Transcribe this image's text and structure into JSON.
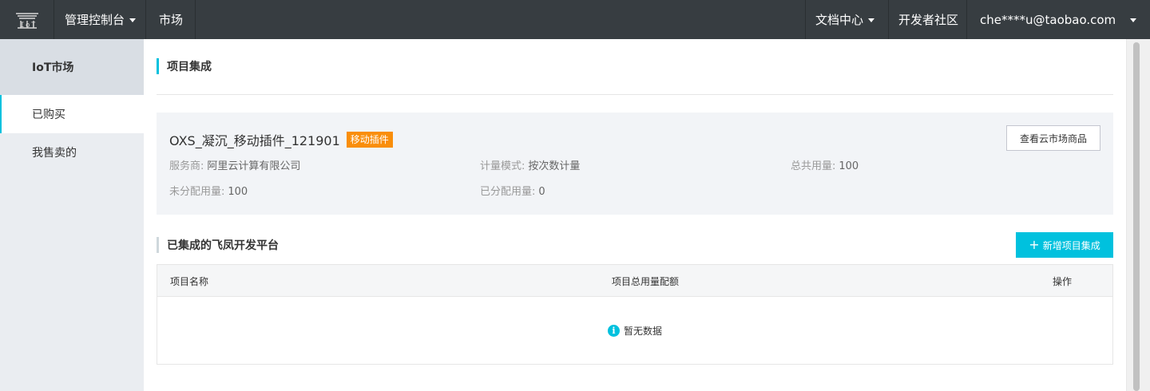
{
  "topbar": {
    "logo_icon": "iot-logo-icon",
    "console_label": "管理控制台",
    "market_label": "市场",
    "docs_label": "文档中心",
    "dev_community_label": "开发者社区",
    "user_label": "che****u@taobao.com"
  },
  "sidebar": {
    "header": "IoT市场",
    "items": [
      {
        "label": "已购买",
        "active": true
      },
      {
        "label": "我售卖的",
        "active": false
      }
    ]
  },
  "main": {
    "section1_title": "项目集成",
    "card": {
      "product_name": "OXS_凝沉_移动插件_121901",
      "tag": "移动插件",
      "view_button": "查看云市场商品",
      "fields": {
        "provider_label": "服务商:",
        "provider_value": "阿里云计算有限公司",
        "metering_label": "计量模式:",
        "metering_value": "按次数计量",
        "total_label": "总共用量:",
        "total_value": "100",
        "unallocated_label": "未分配用量:",
        "unallocated_value": "100",
        "allocated_label": "已分配用量:",
        "allocated_value": "0"
      }
    },
    "section2_title": "已集成的飞凤开发平台",
    "add_button": "新增项目集成",
    "table": {
      "columns": [
        "项目名称",
        "项目总用量配额",
        "操作"
      ],
      "empty_text": "暂无数据"
    }
  },
  "colors": {
    "topbar_bg": "#373d41",
    "accent": "#00c1de",
    "tag_orange": "#f98e0a",
    "sidebar_bg": "#eaedf1"
  }
}
